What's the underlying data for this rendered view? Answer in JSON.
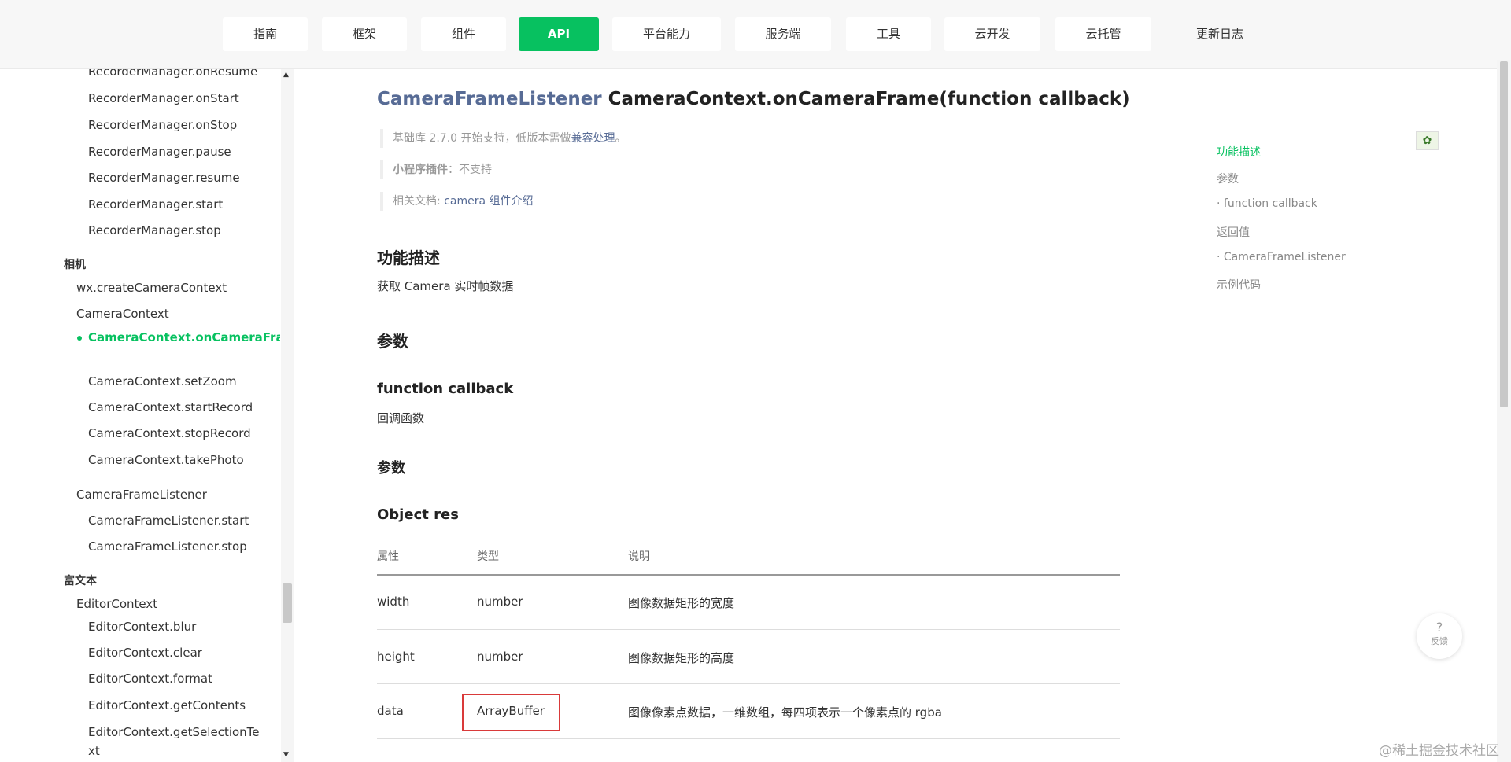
{
  "nav": {
    "items": [
      "指南",
      "框架",
      "组件",
      "API",
      "平台能力",
      "服务端",
      "工具",
      "云开发",
      "云托管",
      "更新日志"
    ],
    "active_index": 3,
    "accent_color": "#07c160"
  },
  "sidebar": {
    "items": [
      "RecorderManager.onResume",
      "RecorderManager.onStart",
      "RecorderManager.onStop",
      "RecorderManager.pause",
      "RecorderManager.resume",
      "RecorderManager.start",
      "RecorderManager.stop",
      "相机",
      "wx.createCameraContext",
      "CameraContext",
      "CameraContext.onCameraFrame",
      "CameraContext.setZoom",
      "CameraContext.startRecord",
      "CameraContext.stopRecord",
      "CameraContext.takePhoto",
      "CameraFrameListener",
      "CameraFrameListener.start",
      "CameraFrameListener.stop",
      "富文本",
      "EditorContext",
      "EditorContext.blur",
      "EditorContext.clear",
      "EditorContext.format",
      "EditorContext.getContents",
      "EditorContext.getSelectionText"
    ]
  },
  "main": {
    "title_type": "CameraFrameListener",
    "title_method": "CameraContext.onCameraFrame(function callback)",
    "note1_text": "基础库 2.7.0 开始支持，低版本需做",
    "note1_link": "兼容处理",
    "note1_end": "。",
    "note2_label": "小程序插件",
    "note2_text": "：不支持",
    "note3_label": "相关文档: ",
    "note3_link": "camera 组件介绍",
    "h_desc": "功能描述",
    "desc": "获取 Camera 实时帧数据",
    "h_params": "参数",
    "h_callback": "function callback",
    "callback_desc": "回调函数",
    "h_params2": "参数",
    "h_object": "Object res",
    "table": {
      "headers": [
        "属性",
        "类型",
        "说明"
      ],
      "rows": [
        [
          "width",
          "number",
          "图像数据矩形的宽度"
        ],
        [
          "height",
          "number",
          "图像数据矩形的高度"
        ],
        [
          "data",
          "ArrayBuffer",
          "图像像素点数据，一维数组，每四项表示一个像素点的 rgba"
        ]
      ]
    }
  },
  "toc": [
    "功能描述",
    "参数",
    "· function callback",
    "返回值",
    "· CameraFrameListener",
    "示例代码"
  ],
  "feedback": {
    "icon": "?",
    "label": "反馈"
  },
  "watermark": "@稀土掘金技术社区"
}
